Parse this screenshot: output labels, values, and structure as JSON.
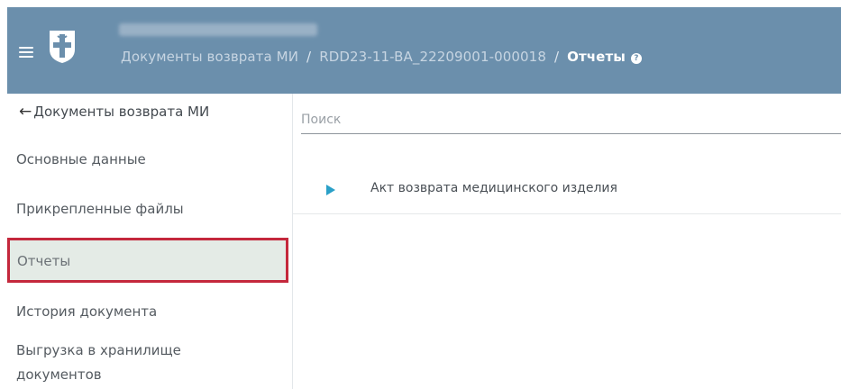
{
  "header": {
    "breadcrumb": [
      "Документы возврата МИ",
      "RDD23-11-BA_22209001-000018"
    ],
    "current": "Отчеты",
    "help_glyph": "?"
  },
  "sidebar": {
    "back_label": "Документы возврата МИ",
    "items": [
      {
        "label": "Основные данные",
        "active": false
      },
      {
        "label": "Прикрепленные файлы",
        "active": false
      },
      {
        "label": "Отчеты",
        "active": true
      },
      {
        "label": "История документа",
        "active": false
      },
      {
        "label": "Выгрузка в хранилище документов",
        "active": false
      }
    ]
  },
  "main": {
    "search_placeholder": "Поиск",
    "reports": [
      {
        "label": "Акт возврата медицинского изделия"
      }
    ]
  },
  "icons": {
    "menu": "menu-icon",
    "logo": "logo-icon",
    "back": "arrow-left-icon",
    "help": "help-circle-icon",
    "expand": "play-triangle-icon"
  },
  "colors": {
    "header_bg": "#6b8fac",
    "active_bg": "#e4ebe6",
    "active_border": "#c4283c",
    "accent": "#2aa0c8"
  }
}
